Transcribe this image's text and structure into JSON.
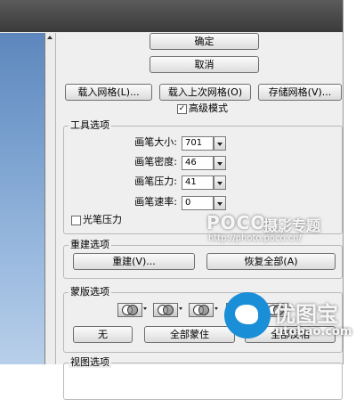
{
  "buttons": {
    "ok": "确定",
    "cancel": "取消",
    "load_mesh": "载入网格(L)...",
    "load_last_mesh": "载入上次网格(O)",
    "save_mesh": "存储网格(V)...",
    "reconstruct": "重建(V)...",
    "restore_all": "恢复全部(A)",
    "none": "无",
    "mask_all": "全部蒙住",
    "invert_all": "全部反相"
  },
  "advanced_mode": {
    "label": "高级模式",
    "checked": true
  },
  "tool_options": {
    "title": "工具选项",
    "fields": [
      {
        "label": "画笔大小:",
        "value": "701"
      },
      {
        "label": "画笔密度:",
        "value": "46"
      },
      {
        "label": "画笔压力:",
        "value": "41"
      },
      {
        "label": "画笔速率:",
        "value": "0"
      }
    ],
    "stylus_pressure": {
      "label": "光笔压力",
      "checked": false
    }
  },
  "reconstruct_options": {
    "title": "重建选项"
  },
  "mask_options": {
    "title": "蒙版选项",
    "icons": [
      "replace-selection-icon",
      "add-to-selection-icon",
      "subtract-from-selection-icon",
      "intersect-with-selection-icon",
      "invert-selection-icon"
    ]
  },
  "view_options": {
    "title": "视图选项"
  },
  "watermarks": {
    "poco_brand": "POCO",
    "poco_title": "摄影专题",
    "poco_url": "http://photo.poco.cn/",
    "utobao_name": "优图宝",
    "utobao_url": "utobao.com"
  },
  "colors": {
    "panel": "#efefef",
    "accent_blue": "#1a8ed6"
  }
}
